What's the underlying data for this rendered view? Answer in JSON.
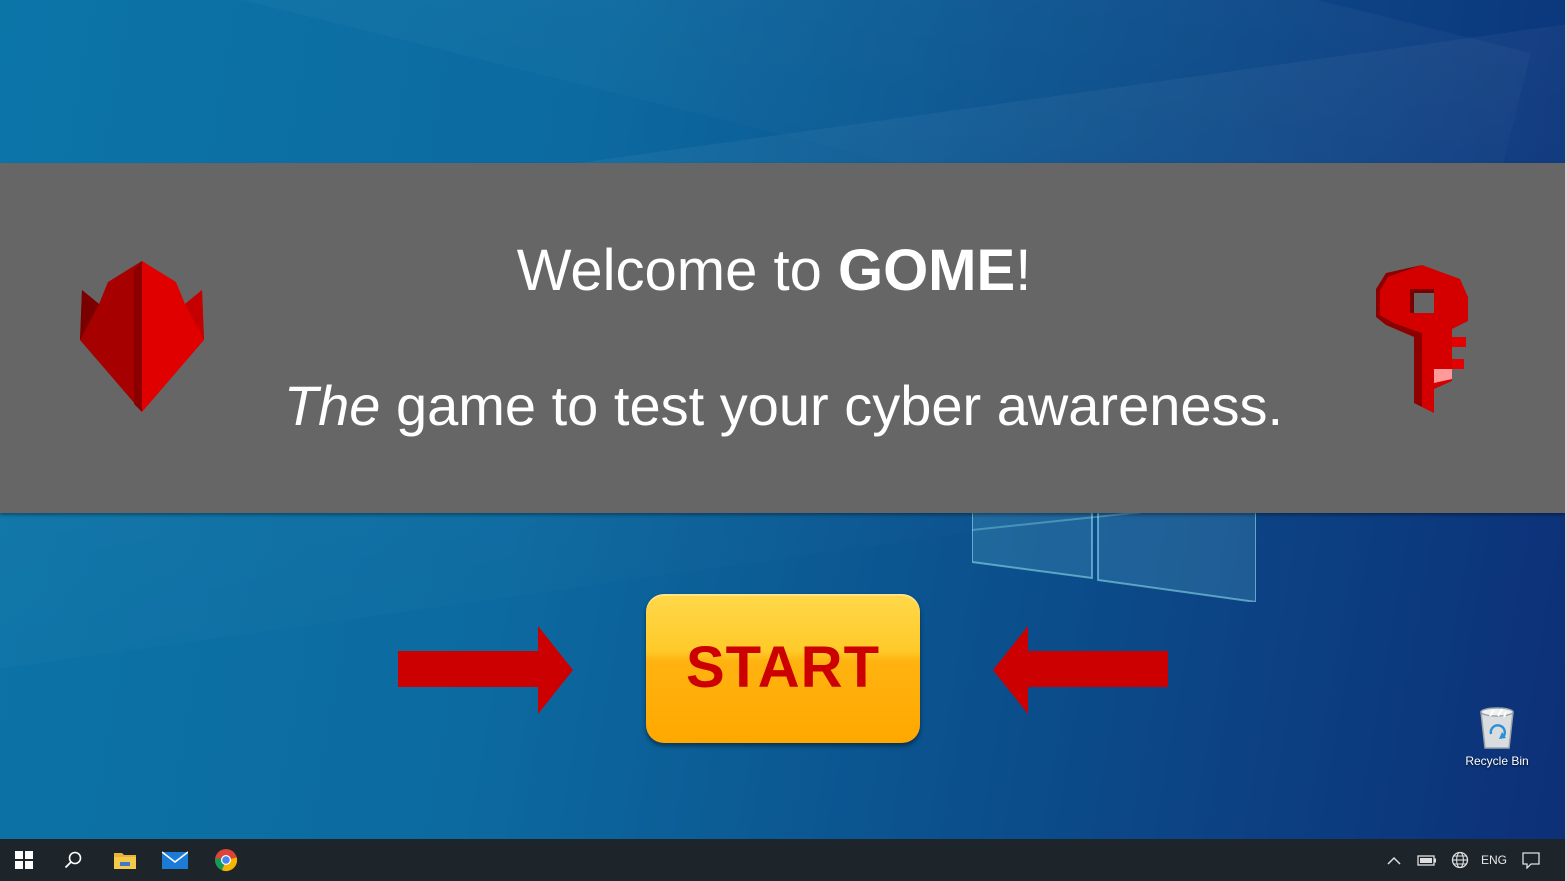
{
  "game": {
    "welcome_prefix": "Welcome to ",
    "title": "GOME",
    "welcome_suffix": "!",
    "tagline_em": "The",
    "tagline_rest": " game to test your cyber awareness.",
    "start_label": "START",
    "left_icon": "shield-icon",
    "right_icon": "key-icon"
  },
  "desktop": {
    "icons": [
      {
        "label": "Recycle Bin",
        "icon": "recycle-bin-icon"
      }
    ]
  },
  "taskbar": {
    "pinned": [
      "start-windows-icon",
      "search-icon",
      "file-explorer-icon",
      "mail-icon",
      "chrome-icon"
    ],
    "tray": {
      "language": "ENG",
      "icons": [
        "chevron-up-icon",
        "battery-icon",
        "network-globe-icon",
        "notifications-icon"
      ]
    }
  },
  "colors": {
    "banner": "#666666",
    "accent_red": "#cc0000",
    "start_button": "#ffb310",
    "taskbar": "#1d252b"
  }
}
